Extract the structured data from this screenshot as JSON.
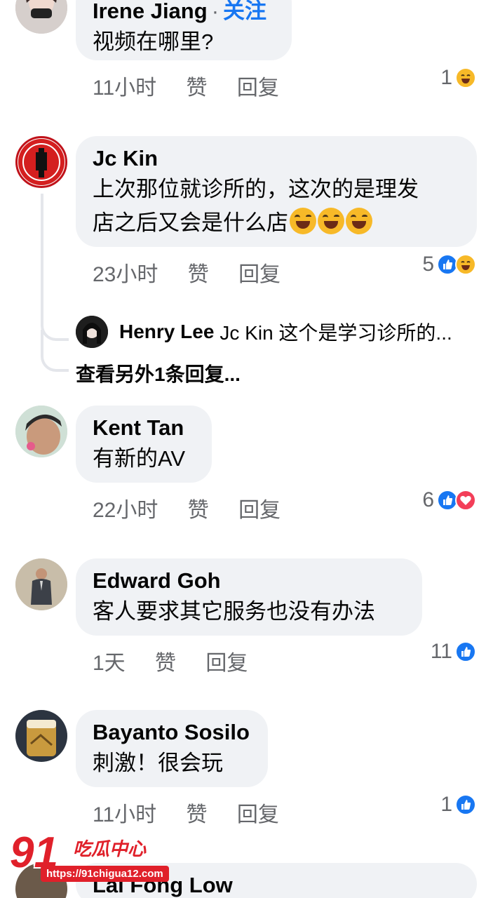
{
  "comments": [
    {
      "author": "Irene Jiang",
      "follow_label": "关注",
      "text": "视频在哪里?",
      "time": "11小时",
      "like_label": "赞",
      "reply_label": "回复",
      "reaction_count": "1",
      "reactions": [
        "haha"
      ]
    },
    {
      "author": "Jc Kin",
      "text_line1": "上次那位就诊所的，这次的是理发",
      "text_line2": "店之后又会是什么店",
      "time": "23小时",
      "like_label": "赞",
      "reply_label": "回复",
      "reaction_count": "5",
      "reactions": [
        "like",
        "haha"
      ],
      "reply_preview": {
        "author": "Henry Lee",
        "text": "Jc Kin 这个是学习诊所的..."
      },
      "more_replies_label": "查看另外1条回复..."
    },
    {
      "author": "Kent Tan",
      "text": "有新的AV",
      "time": "22小时",
      "like_label": "赞",
      "reply_label": "回复",
      "reaction_count": "6",
      "reactions": [
        "like",
        "love"
      ]
    },
    {
      "author": "Edward Goh",
      "text": "客人要求其它服务也没有办法",
      "time": "1天",
      "like_label": "赞",
      "reply_label": "回复",
      "reaction_count": "11",
      "reactions": [
        "like"
      ]
    },
    {
      "author": "Bayanto Sosilo",
      "text": "刺激！很会玩",
      "time": "11小时",
      "like_label": "赞",
      "reply_label": "回复",
      "reaction_count": "1",
      "reactions": [
        "like"
      ]
    },
    {
      "author": "Lai Fong Low"
    }
  ],
  "watermark": {
    "number": "91",
    "name": "吃瓜中心",
    "url": "https://91chigua12.com"
  },
  "colors": {
    "bubble": "#f0f2f5",
    "link": "#1877f2",
    "secondary_text": "#65676b",
    "like": "#1877f2",
    "love": "#f33e58",
    "haha": "#f7b928",
    "watermark": "#e0202a"
  }
}
